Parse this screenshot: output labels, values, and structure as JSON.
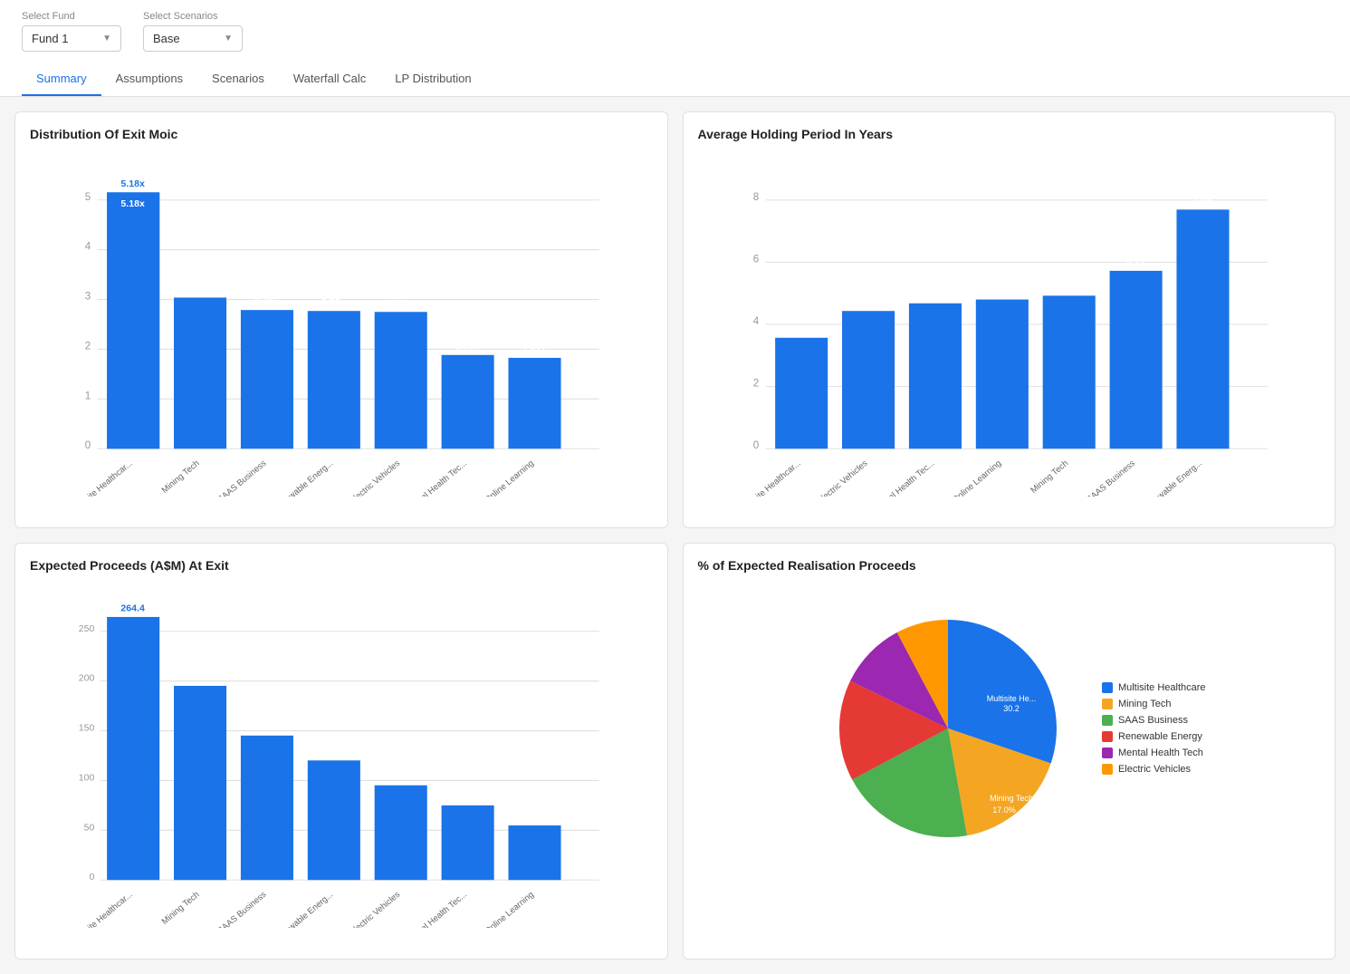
{
  "selectors": {
    "fund_label": "Select Fund",
    "fund_value": "Fund 1",
    "scenario_label": "Select Scenarios",
    "scenario_value": "Base"
  },
  "tabs": [
    {
      "label": "Summary",
      "active": true
    },
    {
      "label": "Assumptions",
      "active": false
    },
    {
      "label": "Scenarios",
      "active": false
    },
    {
      "label": "Waterfall Calc",
      "active": false
    },
    {
      "label": "LP Distribution",
      "active": false
    }
  ],
  "chart1": {
    "title": "Distribution Of Exit Moic",
    "bars": [
      {
        "label": "Multisite Healthcar...",
        "value": 5.18,
        "display": "5.18x"
      },
      {
        "label": "Mining Tech",
        "value": 3.03,
        "display": "3.03x"
      },
      {
        "label": "SAAS Business",
        "value": 2.79,
        "display": "2.79x"
      },
      {
        "label": "Renewable Energ...",
        "value": 2.78,
        "display": "2.78x"
      },
      {
        "label": "Electric Vehicles",
        "value": 2.75,
        "display": "2.75x"
      },
      {
        "label": "Mental Health Tec...",
        "value": 1.89,
        "display": "1.89x"
      },
      {
        "label": "Online Learning",
        "value": 1.82,
        "display": "1.82x"
      }
    ],
    "y_max": 5,
    "y_ticks": [
      0,
      1,
      2,
      3,
      4,
      5
    ]
  },
  "chart2": {
    "title": "Average Holding Period In Years",
    "bars": [
      {
        "label": "Multisite Healthcar...",
        "value": 3.56,
        "display": "3.56"
      },
      {
        "label": "Electric Vehicles",
        "value": 4.42,
        "display": "4.42"
      },
      {
        "label": "Mental Health Tec...",
        "value": 4.68,
        "display": "4.68"
      },
      {
        "label": "Online Learning",
        "value": 4.8,
        "display": "4.8"
      },
      {
        "label": "Mining Tech",
        "value": 4.92,
        "display": "4.92"
      },
      {
        "label": "SAAS Business",
        "value": 5.73,
        "display": "5.73"
      },
      {
        "label": "Renewable Energ...",
        "value": 7.68,
        "display": "7.68"
      }
    ],
    "y_max": 8,
    "y_ticks": [
      0,
      2,
      4,
      6,
      8
    ]
  },
  "chart3": {
    "title": "Expected Proceeds (A$M) At Exit",
    "bars": [
      {
        "label": "Multisite Healthcar...",
        "value": 264.4,
        "display": "264.4"
      },
      {
        "label": "Mining Tech",
        "value": 180,
        "display": ""
      },
      {
        "label": "SAAS Business",
        "value": 160,
        "display": ""
      },
      {
        "label": "Renewable Energ...",
        "value": 140,
        "display": ""
      },
      {
        "label": "Electric Vehicles",
        "value": 120,
        "display": ""
      },
      {
        "label": "Mental Health Tec...",
        "value": 90,
        "display": ""
      },
      {
        "label": "Online Learning",
        "value": 70,
        "display": ""
      }
    ],
    "y_max": 300,
    "y_ticks": [
      0,
      50,
      100,
      150,
      200,
      250
    ]
  },
  "chart4": {
    "title": "% of Expected Realisation Proceeds",
    "segments": [
      {
        "label": "Multisite Healthcare",
        "color": "#1a73e8",
        "pct": 30.2,
        "display": "Multisite He... 30.2"
      },
      {
        "label": "Mining Tech",
        "color": "#f4a623",
        "pct": 17,
        "display": "Mining Tech 17.0%"
      },
      {
        "label": "SAAS Business",
        "color": "#4caf50",
        "pct": 20,
        "display": ""
      },
      {
        "label": "Renewable Energy",
        "color": "#e53935",
        "pct": 15,
        "display": ""
      },
      {
        "label": "Mental Health Tech",
        "color": "#9c27b0",
        "pct": 10,
        "display": ""
      },
      {
        "label": "Electric Vehicles",
        "color": "#ff9800",
        "pct": 8,
        "display": ""
      }
    ],
    "legend": [
      {
        "label": "Multisite Healthcare",
        "color": "#1a73e8"
      },
      {
        "label": "Mining Tech",
        "color": "#f4a623"
      },
      {
        "label": "SAAS Business",
        "color": "#4caf50"
      },
      {
        "label": "Renewable Energy",
        "color": "#e53935"
      },
      {
        "label": "Mental Health Tech",
        "color": "#9c27b0"
      },
      {
        "label": "Electric Vehicles",
        "color": "#ff9800"
      }
    ]
  }
}
